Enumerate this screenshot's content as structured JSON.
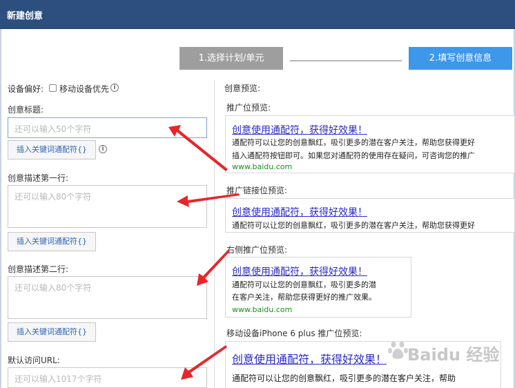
{
  "window": {
    "title": "新建创意"
  },
  "steps": {
    "step1": "1.选择计划/单元",
    "step2": "2.填写创意信息"
  },
  "form": {
    "device_pref_label": "设备偏好:",
    "mobile_first_label": "移动设备优先",
    "title_label": "创意标题:",
    "title_placeholder": "还可以输入50个字符",
    "insert_btn": "插入关键词通配符{}",
    "desc1_label": "创意描述第一行:",
    "desc1_placeholder": "还可以输入80个字符",
    "desc2_label": "创意描述第二行:",
    "desc2_placeholder": "还可以输入80个字符",
    "url_label": "默认访问URL:",
    "url_placeholder": "还可以输入1017个字符"
  },
  "preview": {
    "heading": "创意预览:",
    "slot1_label": "推广位预览:",
    "slot1": {
      "title": "创意使用通配符，获得好效果！",
      "line1": "通配符可以让您的创意飘红，吸引更多的潜在客户关注，帮助您获得更好",
      "line2": "插入通配符按钮即可。如果您对通配符的使用存在疑问，可咨询您的推广",
      "url": "www.baidu.com"
    },
    "slot2_label": "推广链接位预览:",
    "slot2": {
      "title": "创意使用通配符，获得好效果！",
      "line1": "通配符可以让您的创意飘红，吸引更多的潜在客户关注，帮助您获得更好"
    },
    "slot3_label": "右侧推广位预览:",
    "slot3": {
      "title": "创意使用通配符，获得好效果！",
      "line1": "通配符可以让您的创意飘红，吸引更多的潜",
      "line2": "在客户关注，帮助您获得更好的推广效果。",
      "url": "www.baidu.com"
    },
    "slot4_label": "移动设备iPhone 6 plus 推广位预览:",
    "slot4": {
      "title": "创意使用通配符，获得好效果！",
      "line1": "通配符可以让您的创意飘红，吸引更多的潜在客户关注，帮助"
    }
  },
  "watermark": "Baidu 经验",
  "colors": {
    "titlebar": "#2d4f80",
    "step_active": "#3d97ea",
    "step_inactive": "#9e9e9e",
    "arrow": "#e8262a",
    "link": "#2a2ac6",
    "url": "#1e8a1e"
  }
}
